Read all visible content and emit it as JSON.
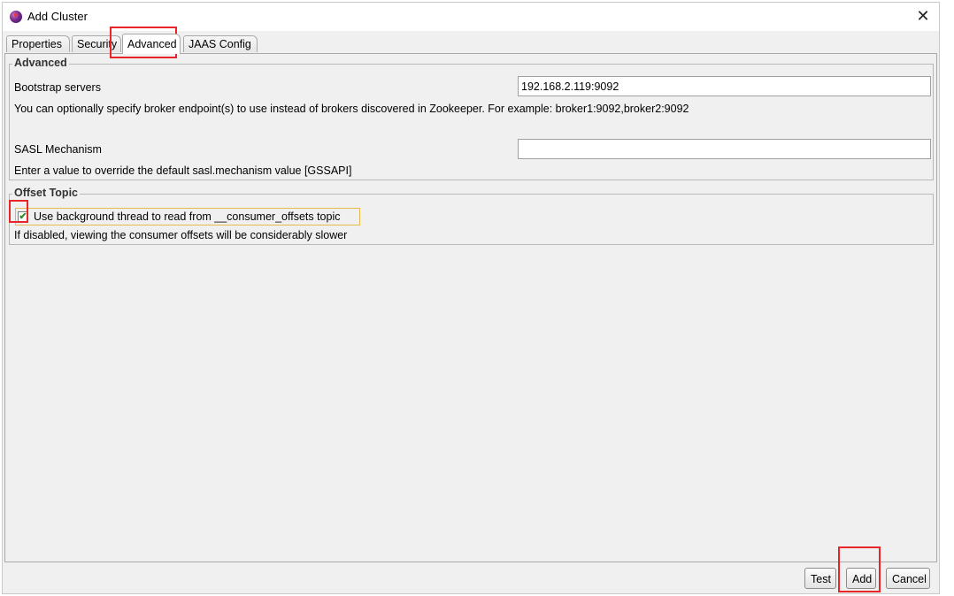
{
  "window": {
    "title": "Add Cluster",
    "app_icon": "kafka-tool-icon",
    "close_icon": "close-icon"
  },
  "tabs": [
    {
      "label": "Properties",
      "active": false
    },
    {
      "label": "Security",
      "active": false
    },
    {
      "label": "Advanced",
      "active": true
    },
    {
      "label": "JAAS Config",
      "active": false
    }
  ],
  "advanced": {
    "legend": "Advanced",
    "bootstrap_label": "Bootstrap servers",
    "bootstrap_value": "192.168.2.119:9092",
    "bootstrap_help": "You can optionally specify broker endpoint(s) to use instead of brokers discovered in Zookeeper. For example: broker1:9092,broker2:9092",
    "sasl_label": "SASL Mechanism",
    "sasl_value": "",
    "sasl_help": "Enter a value to override the default sasl.mechanism value [GSSAPI]"
  },
  "offset_topic": {
    "legend": "Offset Topic",
    "checkbox_label": "Use background thread to read from __consumer_offsets topic",
    "checked": true,
    "check_mark": "✔",
    "help": "If disabled, viewing the consumer offsets will be considerably slower"
  },
  "buttons": {
    "test": "Test",
    "add": "Add",
    "cancel": "Cancel"
  },
  "colors": {
    "highlight": "#e8262a",
    "checkbox_border": "#e6b84e",
    "check_mark": "#2e8b2e"
  }
}
